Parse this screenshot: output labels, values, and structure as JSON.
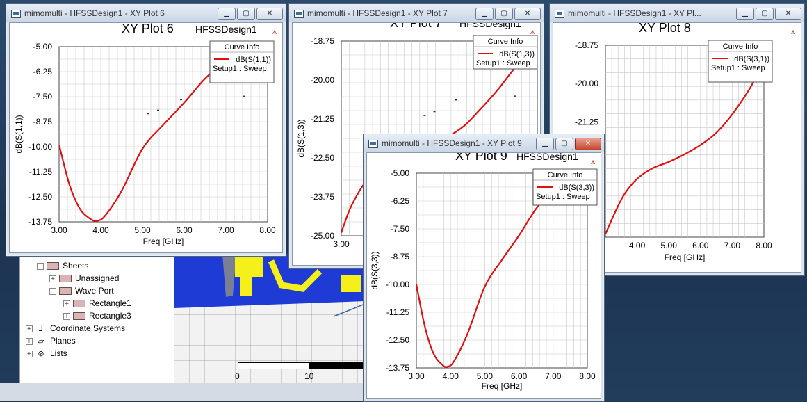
{
  "tree": {
    "items": [
      {
        "label": "Sheets",
        "indent": 1,
        "expander": "minus",
        "kind": "box"
      },
      {
        "label": "Unassigned",
        "indent": 2,
        "expander": "plus",
        "kind": "box"
      },
      {
        "label": "Wave Port",
        "indent": 2,
        "expander": "minus",
        "kind": "box"
      },
      {
        "label": "Rectangle1",
        "indent": 3,
        "expander": "plus",
        "kind": "box"
      },
      {
        "label": "Rectangle3",
        "indent": 3,
        "expander": "plus",
        "kind": "box"
      },
      {
        "label": "Coordinate Systems",
        "indent": 0,
        "expander": "plus",
        "kind": "coord-icon"
      },
      {
        "label": "Planes",
        "indent": 0,
        "expander": "plus",
        "kind": "planes-icon"
      },
      {
        "label": "Lists",
        "indent": 0,
        "expander": "plus",
        "kind": "lists-icon"
      }
    ]
  },
  "scale": {
    "left": "0",
    "mid": "10"
  },
  "colors": {
    "curve": "#e01010",
    "grid": "#c8c8c8",
    "accent": "#c43a2a"
  },
  "windows": [
    {
      "id": "plot6",
      "window_title": "mimomulti - HFSSDesign1 - XY Plot 6",
      "plot_title": "XY Plot 6",
      "design": "HFSSDesign1",
      "legend": {
        "header": "Curve Info",
        "trace": "dB(S(1,1))",
        "setup": "Setup1 : Sweep"
      },
      "controls": {
        "minimize": "▁",
        "maximize": "▢",
        "close": "✕"
      },
      "chart_data": {
        "type": "line",
        "title": "XY Plot 6",
        "xlabel": "Freq [GHz]",
        "ylabel": "dB(S(1,1))",
        "xlim": [
          3.0,
          8.0
        ],
        "ylim": [
          -13.75,
          -5.0
        ],
        "xticks": [
          "3.00",
          "4.00",
          "5.00",
          "6.00",
          "7.00",
          "8.00"
        ],
        "yticks": [
          "-5.00",
          "-6.25",
          "-7.50",
          "-8.75",
          "-10.00",
          "-11.25",
          "-12.50",
          "-13.75"
        ],
        "grid": true,
        "series": [
          {
            "name": "dB(S(1,1))",
            "x": [
              3.0,
              3.25,
              3.5,
              3.75,
              3.9,
              4.1,
              4.5,
              5.0,
              5.5,
              6.0,
              6.5,
              7.0,
              7.5,
              8.0
            ],
            "y": [
              -9.9,
              -11.9,
              -13.1,
              -13.6,
              -13.7,
              -13.45,
              -12.2,
              -10.1,
              -8.9,
              -7.8,
              -6.6,
              -5.7,
              -4.9,
              -4.2
            ]
          }
        ]
      }
    },
    {
      "id": "plot7",
      "window_title": "mimomulti - HFSSDesign1 - XY Plot 7",
      "plot_title": "XY Plot 7",
      "design": "HFSSDesign1",
      "legend": {
        "header": "Curve Info",
        "trace": "dB(S(1,3))",
        "setup": "Setup1 : Sweep"
      },
      "controls": {
        "minimize": "▁",
        "maximize": "▢",
        "close": "✕"
      },
      "chart_data": {
        "type": "line",
        "title": "XY Plot 7",
        "xlabel": "Freq [GHz]",
        "ylabel": "dB(S(1,3))",
        "xlim": [
          3.0,
          8.0
        ],
        "ylim": [
          -25.0,
          -18.75
        ],
        "xticks": [
          "3.00"
        ],
        "yticks": [
          "-18.75",
          "-20.00",
          "-21.25",
          "-22.50",
          "-23.75",
          "-25.00"
        ],
        "grid": true,
        "series": [
          {
            "name": "dB(S(1,3))",
            "x": [
              3.0,
              3.2,
              3.4,
              3.6,
              3.8,
              4.0,
              5.0,
              6.0,
              6.5,
              7.0,
              7.5,
              8.0
            ],
            "y": [
              -24.9,
              -24.2,
              -23.7,
              -23.3,
              -23.0,
              -22.8,
              -22.3,
              -21.6,
              -21.0,
              -20.3,
              -19.5,
              -18.9
            ]
          }
        ]
      }
    },
    {
      "id": "plot8",
      "window_title": "mimomulti - HFSSDesign1 - XY Pl...",
      "plot_title": "XY Plot 8",
      "design": "",
      "legend": {
        "header": "Curve Info",
        "trace": "dB(S(3,1))",
        "setup": "Setup1 : Sweep"
      },
      "controls": {
        "minimize": "▁",
        "maximize": "▢",
        "close": "✕"
      },
      "chart_data": {
        "type": "line",
        "title": "XY Plot 8",
        "xlabel": "Freq [GHz]",
        "ylabel": "",
        "xlim": [
          3.0,
          8.0
        ],
        "ylim": [
          -25.0,
          -18.75
        ],
        "xticks": [
          "4.00",
          "5.00",
          "6.00",
          "7.00",
          "8.00"
        ],
        "yticks": [
          "-18.75",
          "-20.00",
          "-21.25"
        ],
        "grid": true,
        "series": [
          {
            "name": "dB(S(3,1))",
            "x": [
              3.0,
              3.3,
              3.6,
              4.0,
              4.5,
              5.0,
              5.5,
              6.0,
              6.5,
              7.0,
              7.5,
              7.8
            ],
            "y": [
              -24.9,
              -24.2,
              -23.6,
              -23.1,
              -22.75,
              -22.55,
              -22.3,
              -22.0,
              -21.6,
              -21.0,
              -20.25,
              -19.7
            ]
          }
        ]
      }
    },
    {
      "id": "plot9",
      "window_title": "mimomulti - HFSSDesign1 - XY Plot 9",
      "plot_title": "XY Plot 9",
      "design": "HFSSDesign1",
      "legend": {
        "header": "Curve Info",
        "trace": "dB(S(3,3))",
        "setup": "Setup1 : Sweep"
      },
      "controls": {
        "minimize": "▁",
        "maximize": "▢",
        "close": "✕"
      },
      "chart_data": {
        "type": "line",
        "title": "XY Plot 9",
        "xlabel": "Freq [GHz]",
        "ylabel": "dB(S(3,3))",
        "xlim": [
          3.0,
          8.0
        ],
        "ylim": [
          -13.75,
          -5.0
        ],
        "xticks": [
          "3.00",
          "4.00",
          "5.00",
          "6.00",
          "7.00",
          "8.00"
        ],
        "yticks": [
          "-5.00",
          "-6.25",
          "-7.50",
          "-8.75",
          "-10.00",
          "-11.25",
          "-12.50",
          "-13.75"
        ],
        "grid": true,
        "series": [
          {
            "name": "dB(S(3,3))",
            "x": [
              3.0,
              3.25,
              3.5,
              3.75,
              3.9,
              4.1,
              4.5,
              5.0,
              5.5,
              6.0,
              6.5,
              7.0,
              7.5,
              8.0
            ],
            "y": [
              -10.0,
              -11.9,
              -13.1,
              -13.6,
              -13.7,
              -13.45,
              -12.2,
              -10.1,
              -8.9,
              -7.8,
              -6.6,
              -5.7,
              -4.9,
              -4.2
            ]
          }
        ]
      }
    }
  ]
}
